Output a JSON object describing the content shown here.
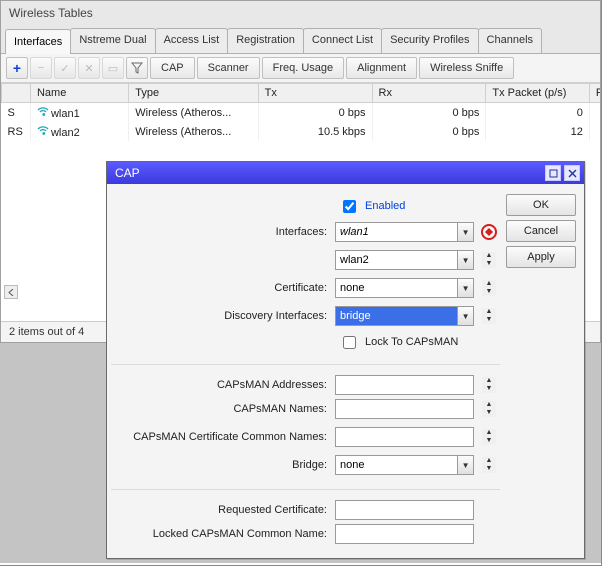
{
  "window": {
    "title": "Wireless Tables"
  },
  "tabs": [
    {
      "label": "Interfaces"
    },
    {
      "label": "Nstreme Dual"
    },
    {
      "label": "Access List"
    },
    {
      "label": "Registration"
    },
    {
      "label": "Connect List"
    },
    {
      "label": "Security Profiles"
    },
    {
      "label": "Channels"
    }
  ],
  "toolbar": {
    "add": "+",
    "remove": "−",
    "enable": "✓",
    "disable": "✕",
    "comment": "▭",
    "filter": "▽",
    "cap": "CAP",
    "scanner": "Scanner",
    "freq": "Freq. Usage",
    "align": "Alignment",
    "sniffer": "Wireless Sniffe"
  },
  "columns": {
    "flags": "",
    "name": "Name",
    "type": "Type",
    "tx": "Tx",
    "rx": "Rx",
    "txp": "Tx Packet (p/s)",
    "r": "R"
  },
  "rows": [
    {
      "flags": "S",
      "name": "wlan1",
      "type": "Wireless (Atheros...",
      "tx": "0 bps",
      "rx": "0 bps",
      "txp": "0"
    },
    {
      "flags": "RS",
      "name": "wlan2",
      "type": "Wireless (Atheros...",
      "tx": "10.5 kbps",
      "rx": "0 bps",
      "txp": "12"
    }
  ],
  "status": "2 items out of 4",
  "cap": {
    "title": "CAP",
    "enabled_label": "Enabled",
    "labels": {
      "interfaces": "Interfaces:",
      "certificate": "Certificate:",
      "discovery": "Discovery Interfaces:",
      "lock": "Lock To CAPsMAN",
      "addresses": "CAPsMAN Addresses:",
      "names": "CAPsMAN Names:",
      "ccn": "CAPsMAN Certificate Common Names:",
      "bridge": "Bridge:",
      "reqcert": "Requested Certificate:",
      "locked": "Locked CAPsMAN Common Name:"
    },
    "values": {
      "iface1": "wlan1",
      "iface2": "wlan2",
      "certificate": "none",
      "discovery": "bridge",
      "addresses": "",
      "names": "",
      "ccn": "",
      "bridge": "none",
      "reqcert": "",
      "locked": ""
    },
    "buttons": {
      "ok": "OK",
      "cancel": "Cancel",
      "apply": "Apply"
    }
  }
}
